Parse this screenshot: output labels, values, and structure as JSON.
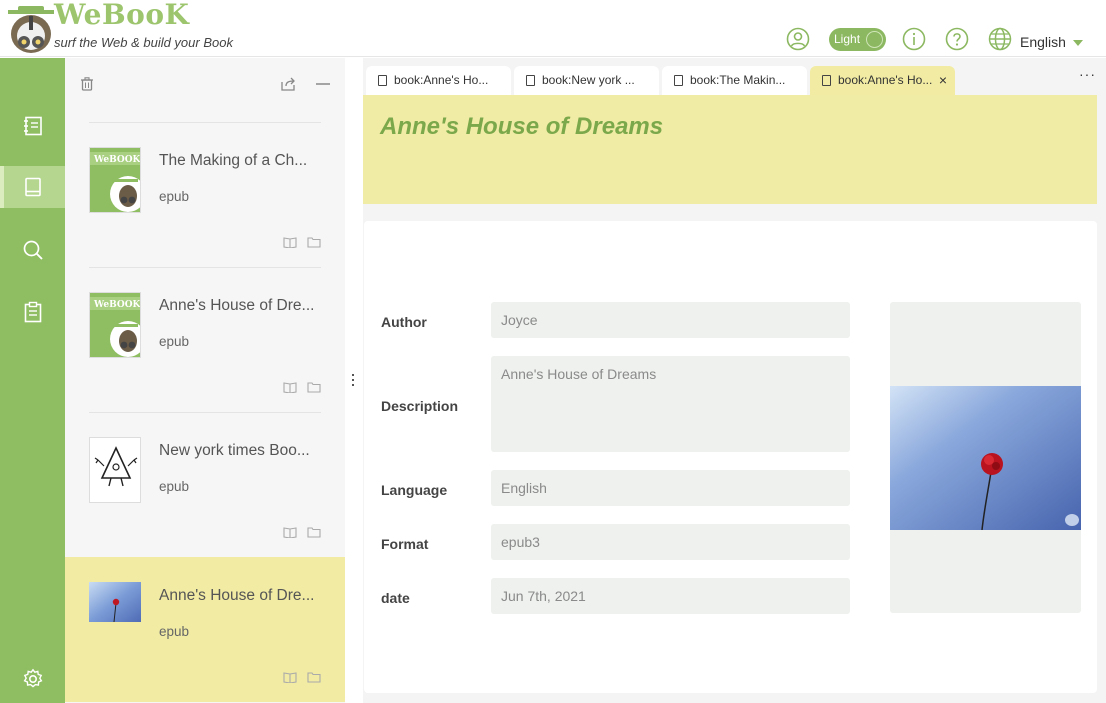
{
  "header": {
    "app_name": "WeBooK",
    "tagline": "surf the Web & build your Book",
    "theme_label": "Light",
    "language": "English"
  },
  "nav": {
    "items": [
      {
        "icon": "notebook-icon"
      },
      {
        "icon": "book-icon",
        "active": true
      },
      {
        "icon": "search-icon"
      },
      {
        "icon": "clipboard-icon"
      }
    ],
    "settings_icon": "gear-icon"
  },
  "book_list": {
    "items": [
      {
        "title": "The Making of a Ch...",
        "format": "epub",
        "cover": "webook-owl"
      },
      {
        "title": "Anne's House of Dre...",
        "format": "epub",
        "cover": "webook-owl"
      },
      {
        "title": "New york times Boo...",
        "format": "epub",
        "cover": "triangle-character"
      },
      {
        "title": "Anne's House of Dre...",
        "format": "epub",
        "cover": "flower-photo",
        "selected": true
      }
    ]
  },
  "tabs": [
    {
      "label": "book:Anne's Ho..."
    },
    {
      "label": "book:New york ..."
    },
    {
      "label": "book:The Makin..."
    },
    {
      "label": "book:Anne's Ho...",
      "active": true,
      "close": "×"
    }
  ],
  "tabs_more": "···",
  "book": {
    "title": "Anne's House of Dreams",
    "fields": {
      "author_label": "Author",
      "author": "Joyce",
      "description_label": "Description",
      "description": "Anne's House of Dreams",
      "language_label": "Language",
      "language": "English",
      "format_label": "Format",
      "format": "epub3",
      "date_label": "date",
      "date": "Jun 7th, 2021"
    }
  },
  "colors": {
    "accent": "#8fbd62",
    "highlight": "#f1eba4",
    "title": "#7aa84a"
  }
}
